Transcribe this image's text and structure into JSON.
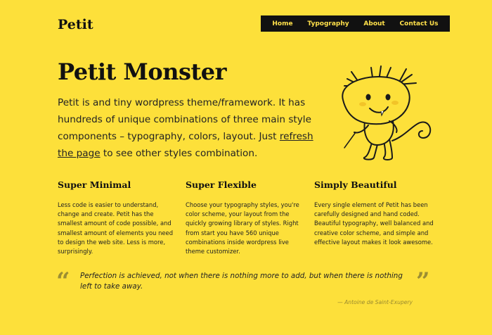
{
  "header": {
    "logo": "Petit",
    "nav": [
      "Home",
      "Typography",
      "About",
      "Contact Us"
    ]
  },
  "hero": {
    "title": "Petit Monster",
    "text_before_link": "Petit is and tiny wordpress theme/framework. It has hundreds of unique combinations of three main style components – typography, colors, layout. Just ",
    "link_text": "refresh the page",
    "text_after_link": " to see other styles combination."
  },
  "features": [
    {
      "title": "Super Minimal",
      "text": "Less code is easier to understand, change and create. Petit has the smallest amount of code possible, and smallest amount of elements you need to design the web site. Less is more, surprisingly."
    },
    {
      "title": "Super Flexible",
      "text": "Choose your typography styles, you're color scheme, your layout from the quickly growing library of styles. Right from start you have 560 unique combinations inside wordpress live theme customizer."
    },
    {
      "title": "Simply Beautiful",
      "text": "Every single element of Petit has been carefully designed and hand coded. Beautiful typography, well balanced and creative color scheme, and simple and effective layout makes it look awesome."
    }
  ],
  "quote": {
    "open_mark": "“",
    "close_mark": "”",
    "text": "Perfection is achieved, not when there is nothing more to add, but when there is nothing left to take away.",
    "author": "— Antoine de Saint-Exupery"
  },
  "colors": {
    "background": "#fde03a",
    "nav_background": "#111111",
    "nav_text": "#ffe04a"
  },
  "icons": [
    "monster-illustration"
  ]
}
